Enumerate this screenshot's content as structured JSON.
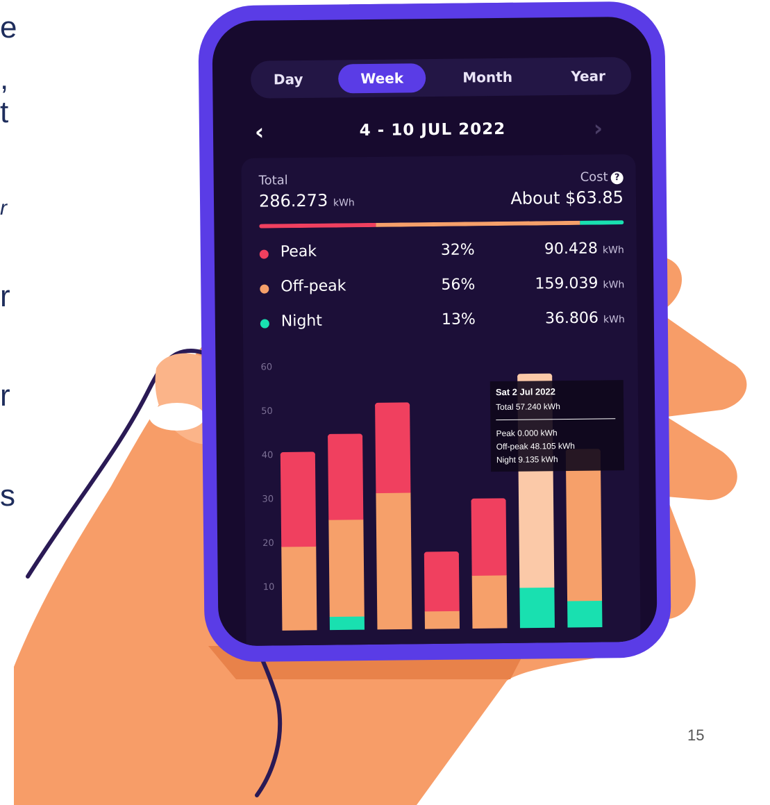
{
  "slide": {
    "edge_fragments": [
      "e",
      ",",
      "t",
      "r",
      "r",
      "r",
      "s"
    ],
    "page_number": "15"
  },
  "app": {
    "tabs": [
      {
        "label": "Day",
        "active": false
      },
      {
        "label": "Week",
        "active": true
      },
      {
        "label": "Month",
        "active": false
      },
      {
        "label": "Year",
        "active": false
      }
    ],
    "date_range": "4 - 10 JUL 2022",
    "prev_icon": "chevron-left-icon",
    "next_icon": "chevron-right-icon",
    "summary": {
      "total_label": "Total",
      "total_value": "286.273",
      "total_unit": "kWh",
      "cost_label": "Cost",
      "cost_value": "About $63.85",
      "help_icon": "question-icon"
    },
    "breakdown": [
      {
        "name": "Peak",
        "percent": "32%",
        "value": "90.428",
        "unit": "kWh",
        "color": "#f0405f"
      },
      {
        "name": "Off-peak",
        "percent": "56%",
        "value": "159.039",
        "unit": "kWh",
        "color": "#f6a06a"
      },
      {
        "name": "Night",
        "percent": "13%",
        "value": "36.806",
        "unit": "kWh",
        "color": "#19e0b0"
      }
    ],
    "tooltip": {
      "title": "Sat 2 Jul 2022",
      "total": "Total 57.240 kWh",
      "peak": "Peak 0.000 kWh",
      "offpeak": "Off-peak 48.105 kWh",
      "night": "Night 9.135 kWh"
    }
  },
  "colors": {
    "phone": "#5a3ce6",
    "screen": "#170a2e",
    "peak": "#f0405f",
    "offpeak": "#f6a06a",
    "night": "#19e0b0",
    "highlight": "#fbc9a8"
  },
  "chart_data": {
    "type": "bar",
    "stacked": true,
    "ylim": [
      0,
      60
    ],
    "yticks": [
      "60",
      "50",
      "40",
      "30",
      "20",
      "10"
    ],
    "series": [
      {
        "name": "Peak",
        "values": [
          21,
          19,
          20,
          13,
          17,
          0,
          0
        ]
      },
      {
        "name": "Off-peak",
        "values": [
          19,
          22,
          31,
          4,
          12,
          48.105,
          34
        ]
      },
      {
        "name": "Night",
        "values": [
          0,
          3,
          0,
          0,
          0,
          9.135,
          6
        ]
      }
    ],
    "highlight_index": 5
  }
}
